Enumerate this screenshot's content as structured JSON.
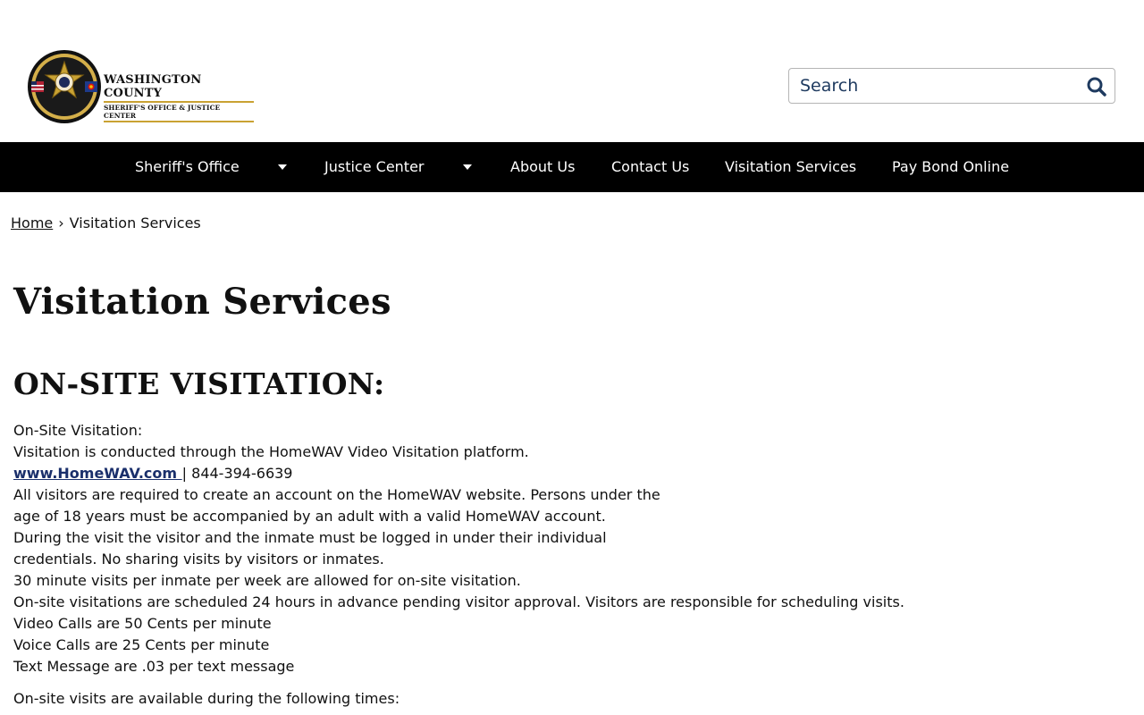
{
  "header": {
    "logo": {
      "line1": "WASHINGTON COUNTY",
      "line2": "SHERIFF'S OFFICE & JUSTICE CENTER",
      "badge_ring_top": "WASHINGTON COUNTY",
      "badge_ring_bottom": "SHERIFF'S OFFICE",
      "colors": {
        "gold": "#c9a233",
        "navy": "#1e2b5a",
        "black": "#111111"
      }
    },
    "search": {
      "placeholder": "Search",
      "icon": "search-icon"
    }
  },
  "nav": {
    "items": [
      {
        "label": "Sheriff's Office",
        "has_dropdown": true
      },
      {
        "label": "Justice Center",
        "has_dropdown": true
      },
      {
        "label": "About Us",
        "has_dropdown": false
      },
      {
        "label": "Contact Us",
        "has_dropdown": false
      },
      {
        "label": "Visitation Services",
        "has_dropdown": false
      },
      {
        "label": "Pay Bond Online",
        "has_dropdown": false
      }
    ],
    "background": "#000000",
    "text_color": "#ffffff"
  },
  "breadcrumb": {
    "home": "Home",
    "separator": "›",
    "current": "Visitation Services"
  },
  "main": {
    "title": "Visitation Services",
    "section_title": "ON-SITE VISITATION:",
    "intro": "On-Site Visitation:",
    "platform": "Visitation is conducted through the HomeWAV Video Visitation platform.",
    "link_text": "www.HomeWAV.com ",
    "phone": "| 844-394-6639",
    "lines": [
      "All visitors are required to create an account on the HomeWAV website. Persons under the",
      "age of 18 years must be accompanied by an adult with a valid HomeWAV account.",
      "During the visit the visitor and the inmate must be logged in under their individual",
      "credentials. No sharing visits by visitors or inmates.",
      "30 minute visits per inmate per week are allowed for on-site visitation.",
      "On-site visitations are scheduled 24 hours in advance pending visitor approval. Visitors are responsible for scheduling visits.",
      "Video Calls are 50 Cents per minute",
      "Voice Calls are 25 Cents per minute",
      "Text Message are .03 per text message"
    ],
    "times_intro": "On-site visits are available during the following times:"
  }
}
